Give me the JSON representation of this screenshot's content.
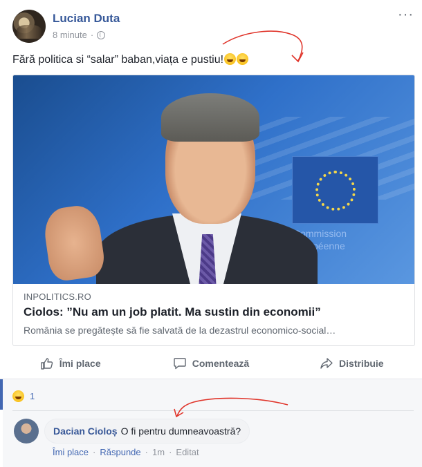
{
  "post": {
    "author": "Lucian Duta",
    "time": "8 minute",
    "separator": "·",
    "more": "···",
    "text": "Fără politica si “salar” baban,viața e pustiu!"
  },
  "link": {
    "domain": "INPOLITICS.RO",
    "title": "Ciolos: ”Nu am un job platit. Ma sustin din economii”",
    "description": "România se pregătește să fie salvată de la dezastrul economico-social…",
    "image_text": "Commission européenne"
  },
  "actions": {
    "like": "Îmi place",
    "comment": "Comentează",
    "share": "Distribuie"
  },
  "reactions": {
    "count": "1"
  },
  "comment": {
    "author": "Dacian Cioloș",
    "text": "O fi pentru dumneavoastră?",
    "like": "Îmi place",
    "sep": "·",
    "reply": "Răspunde",
    "time": "1m",
    "edited": "Editat"
  },
  "colors": {
    "link": "#365899",
    "muted": "#90949c",
    "accent": "#4267b2",
    "annotation": "#e0352b"
  },
  "icons": [
    "globe-icon",
    "more-icon",
    "like-icon",
    "comment-icon",
    "share-icon",
    "haha-emoji-icon"
  ]
}
